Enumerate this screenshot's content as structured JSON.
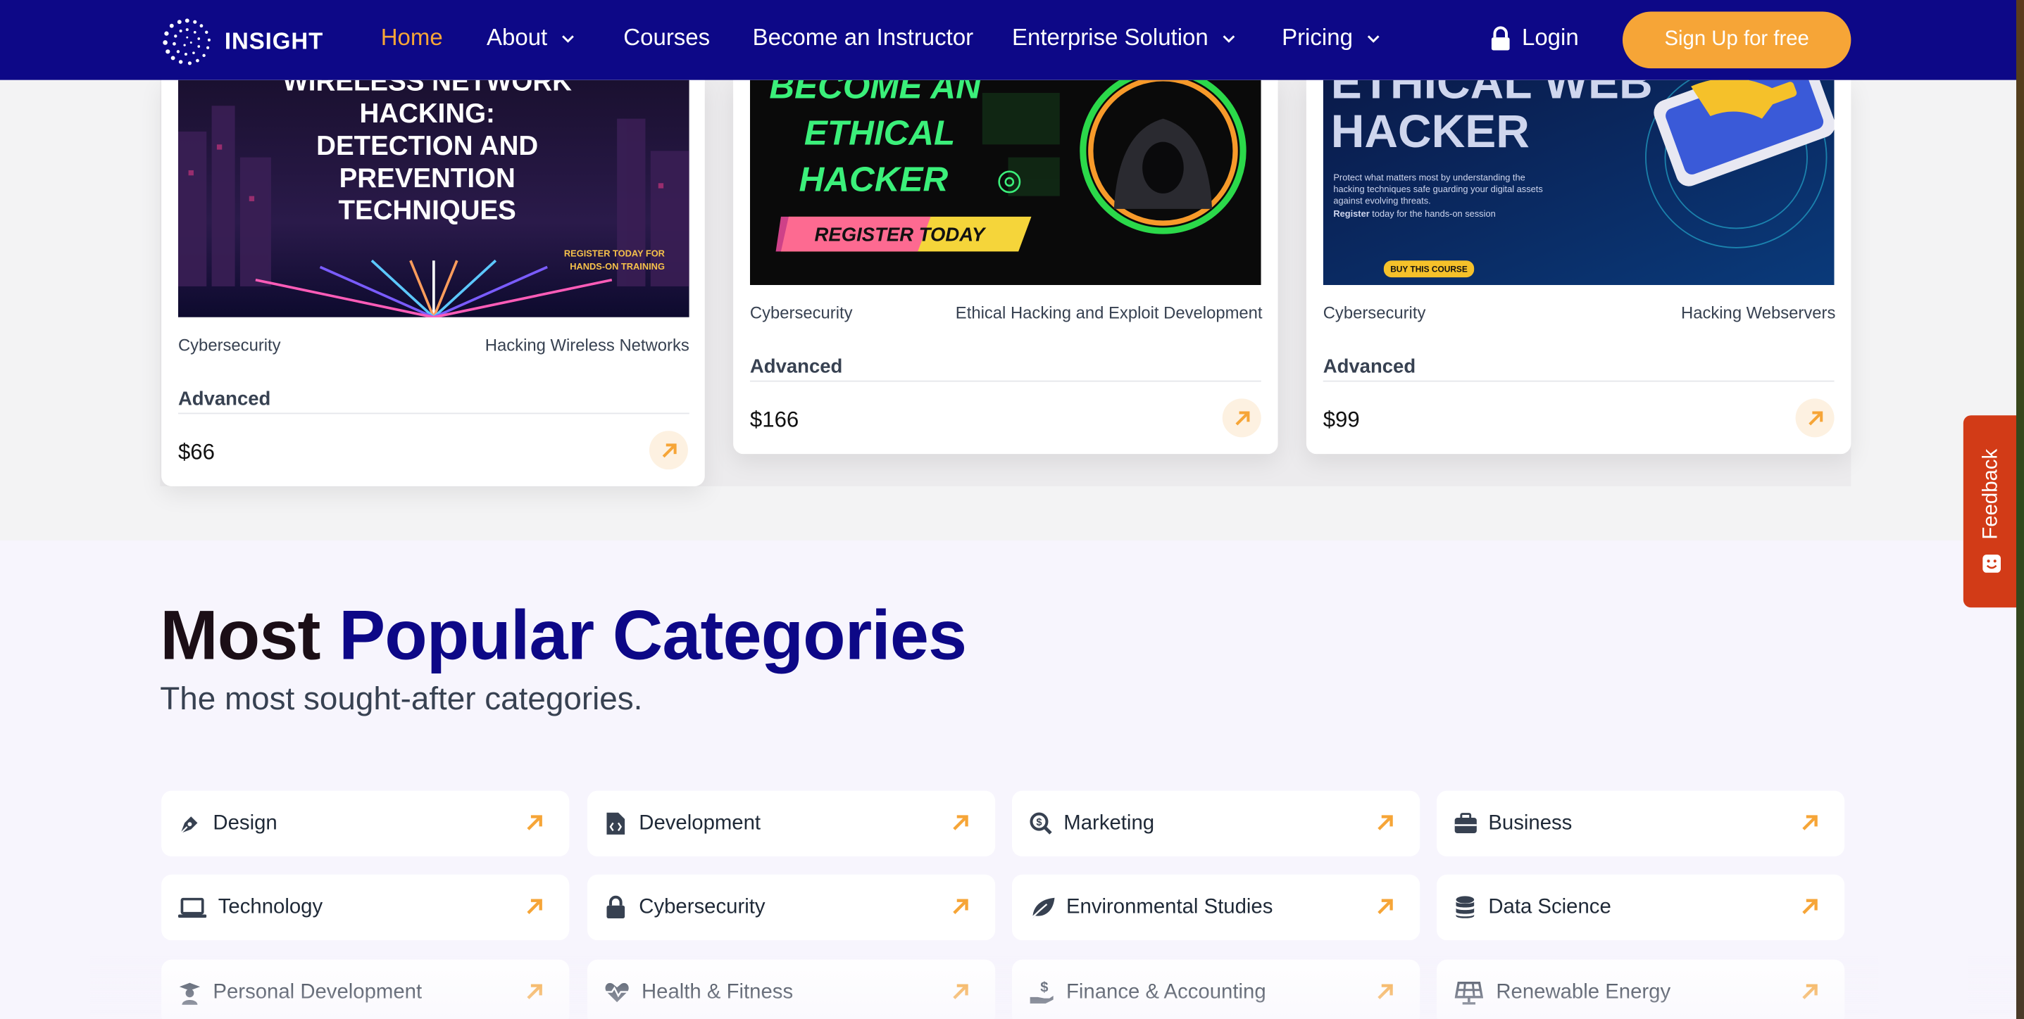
{
  "nav": {
    "brand": "INSIGHT",
    "items": [
      {
        "label": "Home",
        "dropdown": false,
        "active": true
      },
      {
        "label": "About",
        "dropdown": true,
        "active": false
      },
      {
        "label": "Courses",
        "dropdown": false,
        "active": false
      },
      {
        "label": "Become an Instructor",
        "dropdown": false,
        "active": false
      },
      {
        "label": "Enterprise Solution",
        "dropdown": true,
        "active": false
      },
      {
        "label": "Pricing",
        "dropdown": true,
        "active": false
      }
    ],
    "login": "Login",
    "signup": "Sign Up for free"
  },
  "courses": [
    {
      "image_text": [
        "WIRELESS NETWORK",
        "HACKING:",
        "DETECTION AND",
        "PREVENTION",
        "TECHNIQUES"
      ],
      "image_cta": [
        "REGISTER TODAY FOR",
        "HANDS-ON TRAINING"
      ],
      "category": "Cybersecurity",
      "topic": "Hacking Wireless Networks",
      "level": "Advanced",
      "price": "$66"
    },
    {
      "image_text": [
        "BECOME AN",
        "ETHICAL",
        "HACKER"
      ],
      "image_cta": [
        "REGISTER TODAY"
      ],
      "category": "Cybersecurity",
      "topic": "Ethical Hacking and Exploit Development",
      "level": "Advanced",
      "price": "$166"
    },
    {
      "image_text": [
        "ETHICAL WEB",
        "HACKER"
      ],
      "image_body": [
        "Protect what matters most by understanding the",
        "hacking techniques safe guarding your digital assets",
        "against evolving threats."
      ],
      "image_register_bold": "Register",
      "image_register_rest": " today for the hands-on session",
      "image_cta": [
        "BUY THIS COURSE"
      ],
      "category": "Cybersecurity",
      "topic": "Hacking Webservers",
      "level": "Advanced",
      "price": "$99"
    }
  ],
  "categories_section": {
    "title_part1": "Most",
    "title_part2": "Popular Categories",
    "subtitle": "The most sought-after categories.",
    "items": [
      {
        "label": "Design",
        "icon": "pen-nib-icon"
      },
      {
        "label": "Development",
        "icon": "file-code-icon"
      },
      {
        "label": "Marketing",
        "icon": "search-dollar-icon"
      },
      {
        "label": "Business",
        "icon": "briefcase-icon"
      },
      {
        "label": "Technology",
        "icon": "laptop-icon"
      },
      {
        "label": "Cybersecurity",
        "icon": "lock-icon"
      },
      {
        "label": "Environmental Studies",
        "icon": "leaf-icon"
      },
      {
        "label": "Data Science",
        "icon": "database-icon"
      },
      {
        "label": "Personal Development",
        "icon": "graduate-icon"
      },
      {
        "label": "Health & Fitness",
        "icon": "heartbeat-icon"
      },
      {
        "label": "Finance & Accounting",
        "icon": "hand-dollar-icon"
      },
      {
        "label": "Renewable Energy",
        "icon": "solar-panel-icon"
      }
    ]
  },
  "feedback": {
    "label": "Feedback"
  },
  "colors": {
    "nav_bg": "#0d0887",
    "accent": "#f6a537",
    "title_dark": "#1b0e16",
    "feedback_bg": "#d23b17"
  }
}
